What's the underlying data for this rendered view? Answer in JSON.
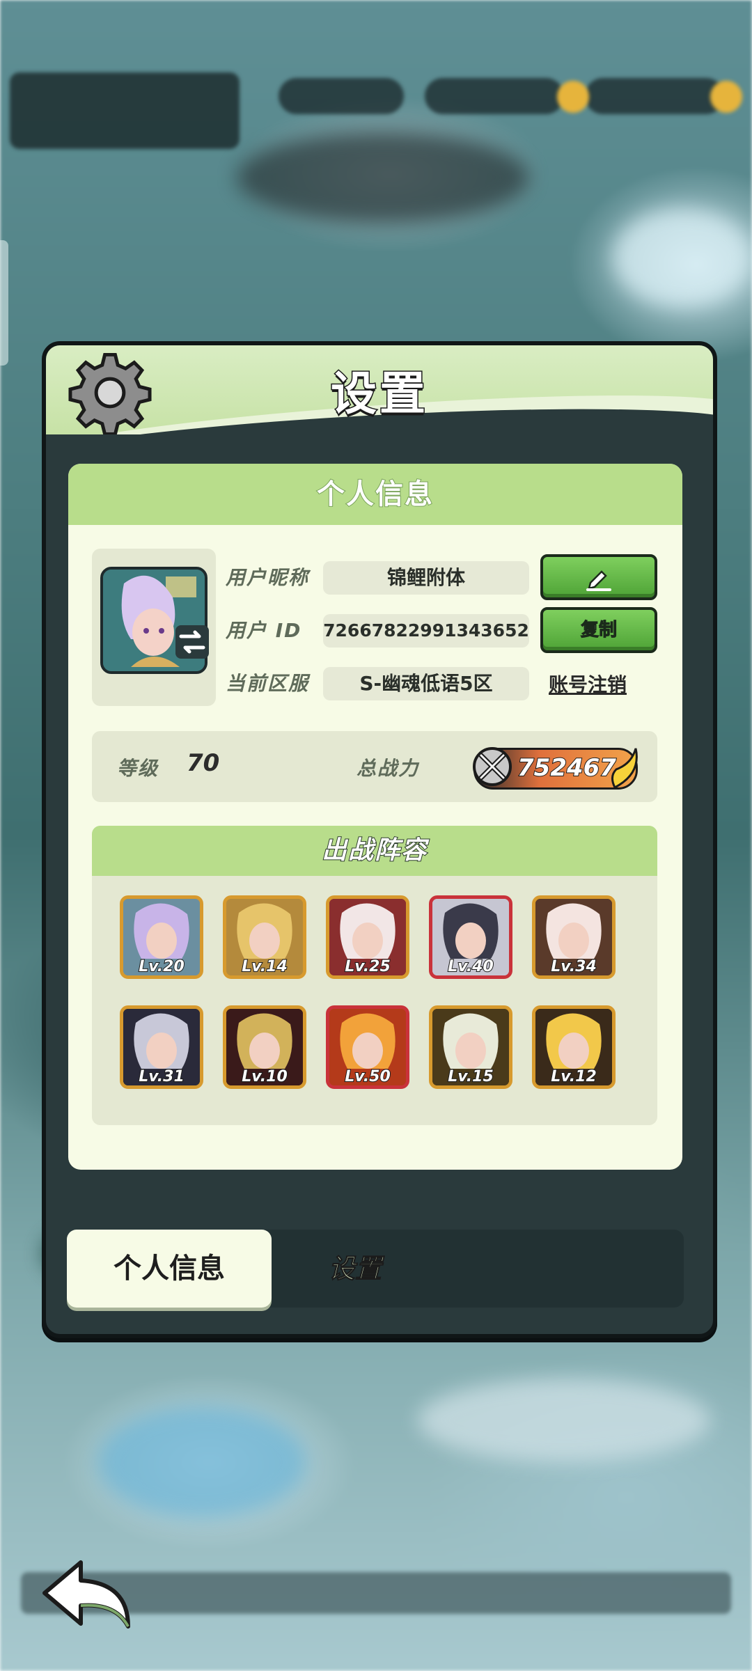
{
  "panel": {
    "title": "设置",
    "gear_icon": "gear-icon"
  },
  "profile": {
    "section_title": "个人信息",
    "nickname_label": "用户昵称",
    "nickname_value": "锦鲤附体",
    "edit_icon": "pencil-icon",
    "user_id_label": "用户 ID",
    "user_id_value": "7266782299134365‌2",
    "copy_label": "复制",
    "server_label": "当前区服",
    "server_value": "S-幽魂低语5区",
    "delete_account_label": "账号注销"
  },
  "stats": {
    "level_label": "等级",
    "level_value": "70",
    "power_label": "总战力",
    "power_value": "752467"
  },
  "lineup": {
    "title": "出战阵容",
    "heroes": [
      {
        "lv": "Lv.20",
        "color": "#6b8fa0",
        "accent": "#c8b4e8",
        "frame": "gold"
      },
      {
        "lv": "Lv.14",
        "color": "#b48a3c",
        "accent": "#e6c46a",
        "frame": "gold"
      },
      {
        "lv": "Lv.25",
        "color": "#8a2e2e",
        "accent": "#f2e6e6",
        "frame": "gold"
      },
      {
        "lv": "Lv.40",
        "color": "#c6c6d2",
        "accent": "#3a3a4a",
        "frame": "red"
      },
      {
        "lv": "Lv.34",
        "color": "#5a3a2a",
        "accent": "#f4e4e0",
        "frame": "gold"
      },
      {
        "lv": "Lv.31",
        "color": "#2a2a3a",
        "accent": "#c8c8d8",
        "frame": "gold"
      },
      {
        "lv": "Lv.10",
        "color": "#3a1a1a",
        "accent": "#d2b25a",
        "frame": "gold"
      },
      {
        "lv": "Lv.50",
        "color": "#b43a1a",
        "accent": "#f2a23a",
        "frame": "red"
      },
      {
        "lv": "Lv.15",
        "color": "#4a3a1a",
        "accent": "#e8ead8",
        "frame": "gold"
      },
      {
        "lv": "Lv.12",
        "color": "#3a2a1a",
        "accent": "#f2c84a",
        "frame": "gold"
      }
    ]
  },
  "tabs": {
    "active": "个人信息",
    "inactive": "设置"
  },
  "nav": {
    "back_icon": "back-arrow-icon"
  }
}
